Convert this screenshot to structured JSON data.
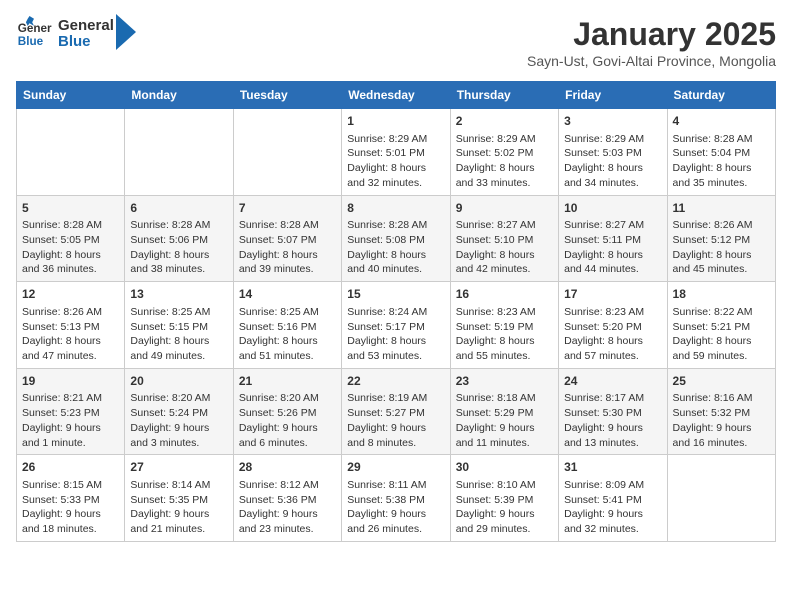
{
  "header": {
    "logo_general": "General",
    "logo_blue": "Blue",
    "month_title": "January 2025",
    "subtitle": "Sayn-Ust, Govi-Altai Province, Mongolia"
  },
  "weekdays": [
    "Sunday",
    "Monday",
    "Tuesday",
    "Wednesday",
    "Thursday",
    "Friday",
    "Saturday"
  ],
  "weeks": [
    [
      {
        "day": "",
        "info": ""
      },
      {
        "day": "",
        "info": ""
      },
      {
        "day": "",
        "info": ""
      },
      {
        "day": "1",
        "info": "Sunrise: 8:29 AM\nSunset: 5:01 PM\nDaylight: 8 hours\nand 32 minutes."
      },
      {
        "day": "2",
        "info": "Sunrise: 8:29 AM\nSunset: 5:02 PM\nDaylight: 8 hours\nand 33 minutes."
      },
      {
        "day": "3",
        "info": "Sunrise: 8:29 AM\nSunset: 5:03 PM\nDaylight: 8 hours\nand 34 minutes."
      },
      {
        "day": "4",
        "info": "Sunrise: 8:28 AM\nSunset: 5:04 PM\nDaylight: 8 hours\nand 35 minutes."
      }
    ],
    [
      {
        "day": "5",
        "info": "Sunrise: 8:28 AM\nSunset: 5:05 PM\nDaylight: 8 hours\nand 36 minutes."
      },
      {
        "day": "6",
        "info": "Sunrise: 8:28 AM\nSunset: 5:06 PM\nDaylight: 8 hours\nand 38 minutes."
      },
      {
        "day": "7",
        "info": "Sunrise: 8:28 AM\nSunset: 5:07 PM\nDaylight: 8 hours\nand 39 minutes."
      },
      {
        "day": "8",
        "info": "Sunrise: 8:28 AM\nSunset: 5:08 PM\nDaylight: 8 hours\nand 40 minutes."
      },
      {
        "day": "9",
        "info": "Sunrise: 8:27 AM\nSunset: 5:10 PM\nDaylight: 8 hours\nand 42 minutes."
      },
      {
        "day": "10",
        "info": "Sunrise: 8:27 AM\nSunset: 5:11 PM\nDaylight: 8 hours\nand 44 minutes."
      },
      {
        "day": "11",
        "info": "Sunrise: 8:26 AM\nSunset: 5:12 PM\nDaylight: 8 hours\nand 45 minutes."
      }
    ],
    [
      {
        "day": "12",
        "info": "Sunrise: 8:26 AM\nSunset: 5:13 PM\nDaylight: 8 hours\nand 47 minutes."
      },
      {
        "day": "13",
        "info": "Sunrise: 8:25 AM\nSunset: 5:15 PM\nDaylight: 8 hours\nand 49 minutes."
      },
      {
        "day": "14",
        "info": "Sunrise: 8:25 AM\nSunset: 5:16 PM\nDaylight: 8 hours\nand 51 minutes."
      },
      {
        "day": "15",
        "info": "Sunrise: 8:24 AM\nSunset: 5:17 PM\nDaylight: 8 hours\nand 53 minutes."
      },
      {
        "day": "16",
        "info": "Sunrise: 8:23 AM\nSunset: 5:19 PM\nDaylight: 8 hours\nand 55 minutes."
      },
      {
        "day": "17",
        "info": "Sunrise: 8:23 AM\nSunset: 5:20 PM\nDaylight: 8 hours\nand 57 minutes."
      },
      {
        "day": "18",
        "info": "Sunrise: 8:22 AM\nSunset: 5:21 PM\nDaylight: 8 hours\nand 59 minutes."
      }
    ],
    [
      {
        "day": "19",
        "info": "Sunrise: 8:21 AM\nSunset: 5:23 PM\nDaylight: 9 hours\nand 1 minute."
      },
      {
        "day": "20",
        "info": "Sunrise: 8:20 AM\nSunset: 5:24 PM\nDaylight: 9 hours\nand 3 minutes."
      },
      {
        "day": "21",
        "info": "Sunrise: 8:20 AM\nSunset: 5:26 PM\nDaylight: 9 hours\nand 6 minutes."
      },
      {
        "day": "22",
        "info": "Sunrise: 8:19 AM\nSunset: 5:27 PM\nDaylight: 9 hours\nand 8 minutes."
      },
      {
        "day": "23",
        "info": "Sunrise: 8:18 AM\nSunset: 5:29 PM\nDaylight: 9 hours\nand 11 minutes."
      },
      {
        "day": "24",
        "info": "Sunrise: 8:17 AM\nSunset: 5:30 PM\nDaylight: 9 hours\nand 13 minutes."
      },
      {
        "day": "25",
        "info": "Sunrise: 8:16 AM\nSunset: 5:32 PM\nDaylight: 9 hours\nand 16 minutes."
      }
    ],
    [
      {
        "day": "26",
        "info": "Sunrise: 8:15 AM\nSunset: 5:33 PM\nDaylight: 9 hours\nand 18 minutes."
      },
      {
        "day": "27",
        "info": "Sunrise: 8:14 AM\nSunset: 5:35 PM\nDaylight: 9 hours\nand 21 minutes."
      },
      {
        "day": "28",
        "info": "Sunrise: 8:12 AM\nSunset: 5:36 PM\nDaylight: 9 hours\nand 23 minutes."
      },
      {
        "day": "29",
        "info": "Sunrise: 8:11 AM\nSunset: 5:38 PM\nDaylight: 9 hours\nand 26 minutes."
      },
      {
        "day": "30",
        "info": "Sunrise: 8:10 AM\nSunset: 5:39 PM\nDaylight: 9 hours\nand 29 minutes."
      },
      {
        "day": "31",
        "info": "Sunrise: 8:09 AM\nSunset: 5:41 PM\nDaylight: 9 hours\nand 32 minutes."
      },
      {
        "day": "",
        "info": ""
      }
    ]
  ]
}
